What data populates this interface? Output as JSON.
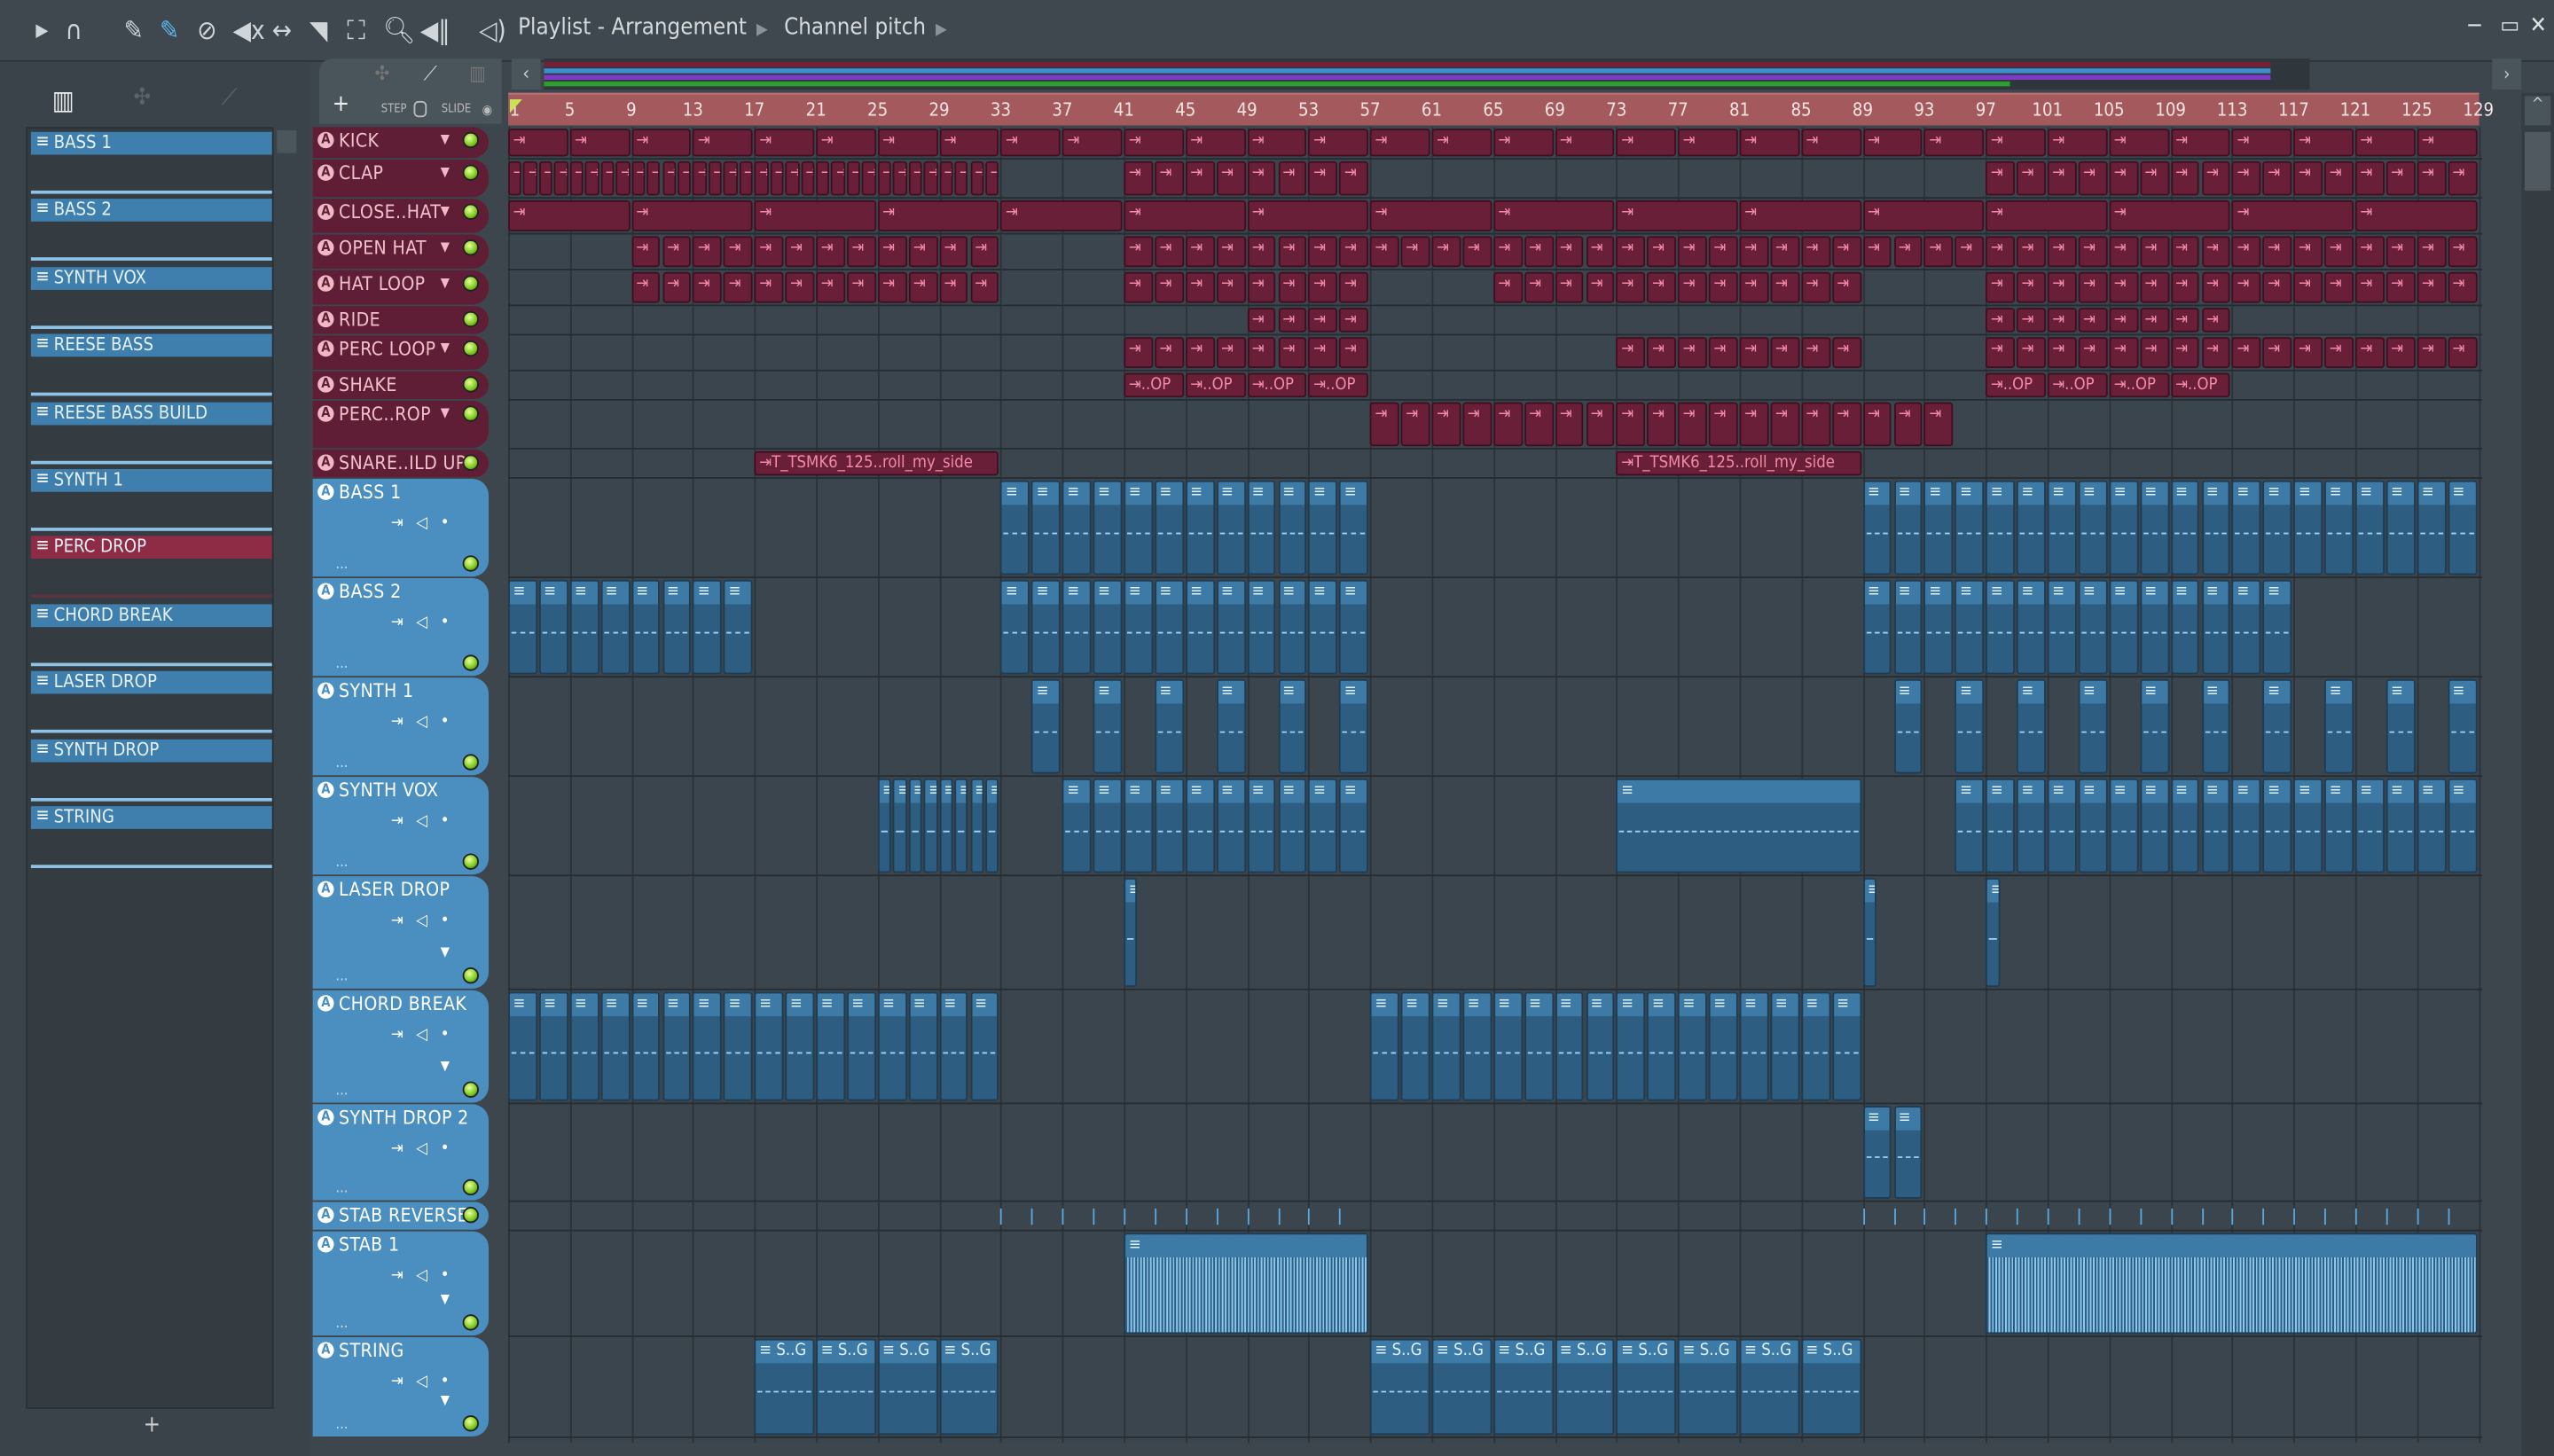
{
  "toolbar": {
    "title": "Playlist - Arrangement",
    "subtitle": "Channel pitch",
    "icons": [
      "play-arrow-icon",
      "magnet-icon",
      "pencil-icon",
      "paint-brush-icon",
      "delete-icon",
      "mute-icon",
      "slip-icon",
      "slice-icon",
      "select-icon",
      "zoom-icon",
      "playback-icon"
    ],
    "step_label": "STEP",
    "slide_label": "SLIDE",
    "add_label": "+"
  },
  "patterns": [
    {
      "label": "BASS 1"
    },
    {
      "label": "BASS 2"
    },
    {
      "label": "SYNTH VOX"
    },
    {
      "label": "REESE BASS"
    },
    {
      "label": "REESE BASS BUILD"
    },
    {
      "label": "SYNTH 1"
    },
    {
      "label": "PERC DROP",
      "red": true
    },
    {
      "label": "CHORD BREAK"
    },
    {
      "label": "LASER DROP"
    },
    {
      "label": "SYNTH DROP"
    },
    {
      "label": "STRING"
    }
  ],
  "pattern_add": "+",
  "ruler": {
    "bars": [
      1,
      5,
      9,
      13,
      17,
      21,
      25,
      29,
      33,
      37,
      41,
      45,
      49,
      53,
      57,
      61,
      65,
      69,
      73,
      77,
      81,
      85,
      89,
      93,
      97,
      101,
      105,
      109,
      113,
      117,
      121,
      125,
      129
    ]
  },
  "colors": {
    "audio": "#6a1f39",
    "pattern": "#2d5d80",
    "ruler": "#a4595d"
  },
  "tracks": [
    {
      "name": "KICK",
      "type": "audio",
      "dd": true,
      "clips": [
        {
          "s": 1,
          "e": 33,
          "len": 4,
          "label": ""
        },
        {
          "s": 33,
          "e": 129,
          "len": 4,
          "label": ""
        }
      ]
    },
    {
      "name": "CLAP",
      "type": "audio",
      "dd": true,
      "clips": [
        {
          "s": 1,
          "e": 33,
          "len": 1,
          "label": ""
        },
        {
          "s": 41,
          "e": 57,
          "len": 2,
          "label": ""
        },
        {
          "s": 97,
          "e": 129,
          "len": 2,
          "label": ""
        }
      ]
    },
    {
      "name": "CLOSE..HAT",
      "type": "audio",
      "dd": true,
      "clips": [
        {
          "s": 1,
          "e": 129,
          "len": 8,
          "label": ""
        }
      ]
    },
    {
      "name": "OPEN HAT",
      "type": "audio",
      "dd": true,
      "clips": [
        {
          "s": 9,
          "e": 33,
          "len": 2,
          "label": ""
        },
        {
          "s": 41,
          "e": 129,
          "len": 2,
          "label": ""
        }
      ]
    },
    {
      "name": "HAT LOOP",
      "type": "audio",
      "dd": true,
      "clips": [
        {
          "s": 9,
          "e": 33,
          "len": 2,
          "label": ""
        },
        {
          "s": 41,
          "e": 57,
          "len": 2,
          "label": ""
        },
        {
          "s": 65,
          "e": 89,
          "len": 2,
          "label": ""
        },
        {
          "s": 97,
          "e": 129,
          "len": 2,
          "label": ""
        }
      ]
    },
    {
      "name": "RIDE",
      "type": "audio",
      "dd": false,
      "clips": [
        {
          "s": 49,
          "e": 57,
          "len": 2,
          "label": ""
        },
        {
          "s": 97,
          "e": 113,
          "len": 2,
          "label": ""
        }
      ]
    },
    {
      "name": "PERC LOOP",
      "type": "audio",
      "dd": true,
      "clips": [
        {
          "s": 41,
          "e": 57,
          "len": 2,
          "label": ""
        },
        {
          "s": 73,
          "e": 89,
          "len": 2,
          "label": ""
        },
        {
          "s": 97,
          "e": 129,
          "len": 2,
          "label": ""
        }
      ]
    },
    {
      "name": "SHAKE",
      "type": "audio",
      "dd": false,
      "clips": [
        {
          "s": 41,
          "e": 57,
          "len": 4,
          "label": "..OP"
        },
        {
          "s": 97,
          "e": 113,
          "len": 4,
          "label": "..OP"
        }
      ]
    },
    {
      "name": "PERC..ROP",
      "type": "audio",
      "dd": true,
      "clips": [
        {
          "s": 57,
          "e": 89,
          "len": 2,
          "label": ""
        },
        {
          "s": 89,
          "e": 95,
          "len": 2,
          "label": ""
        }
      ]
    },
    {
      "name": "SNARE..ILD UP",
      "type": "audio",
      "dd": false,
      "clips": [
        {
          "s": 17,
          "e": 33,
          "len": 16,
          "label": "T_TSMK6_125..roll_my_side"
        },
        {
          "s": 73,
          "e": 89,
          "len": 16,
          "label": "T_TSMK6_125..roll_my_side"
        }
      ]
    },
    {
      "name": "BASS 1",
      "type": "inst",
      "clips": [
        {
          "s": 33,
          "e": 57,
          "len": 2,
          "label": ""
        },
        {
          "s": 89,
          "e": 129,
          "len": 2,
          "label": ""
        }
      ]
    },
    {
      "name": "BASS 2",
      "type": "inst",
      "clips": [
        {
          "s": 1,
          "e": 17,
          "len": 2,
          "label": ""
        },
        {
          "s": 33,
          "e": 57,
          "len": 2,
          "label": ""
        },
        {
          "s": 89,
          "e": 117,
          "len": 2,
          "label": ""
        }
      ]
    },
    {
      "name": "SYNTH 1",
      "type": "inst",
      "clips": [
        {
          "s": 35,
          "e": 57,
          "len": 2,
          "gap": 2,
          "label": ""
        },
        {
          "s": 91,
          "e": 129,
          "len": 2,
          "gap": 2,
          "label": ""
        }
      ]
    },
    {
      "name": "SYNTH VOX",
      "type": "inst",
      "clips": [
        {
          "s": 25,
          "e": 33,
          "len": 1,
          "label": ""
        },
        {
          "s": 37,
          "e": 57,
          "len": 2,
          "label": ""
        },
        {
          "s": 73,
          "e": 89,
          "len": 16,
          "label": ""
        },
        {
          "s": 95,
          "e": 129,
          "len": 2,
          "label": ""
        }
      ]
    },
    {
      "name": "LASER DROP",
      "type": "inst",
      "dd": true,
      "clips": [
        {
          "s": 41,
          "e": 42,
          "len": 1,
          "label": ""
        },
        {
          "s": 89,
          "e": 90,
          "len": 1,
          "label": ""
        },
        {
          "s": 97,
          "e": 98,
          "len": 1,
          "label": ""
        }
      ]
    },
    {
      "name": "CHORD BREAK",
      "type": "inst",
      "dd": true,
      "clips": [
        {
          "s": 1,
          "e": 33,
          "len": 2,
          "label": ""
        },
        {
          "s": 57,
          "e": 89,
          "len": 2,
          "label": ""
        }
      ]
    },
    {
      "name": "SYNTH DROP 2",
      "type": "inst",
      "clips": [
        {
          "s": 89,
          "e": 91,
          "len": 2,
          "label": ""
        },
        {
          "s": 91,
          "e": 93,
          "len": 2,
          "label": ""
        }
      ]
    },
    {
      "name": "STAB REVERSE",
      "type": "inst",
      "small": true,
      "clips": []
    },
    {
      "name": "STAB 1",
      "type": "inst",
      "dd": true,
      "wave": true,
      "clips": [
        {
          "s": 41,
          "e": 57,
          "len": 16,
          "label": ""
        },
        {
          "s": 97,
          "e": 129,
          "len": 32,
          "label": ""
        }
      ]
    },
    {
      "name": "STRING",
      "type": "inst",
      "dd": true,
      "clips": [
        {
          "s": 17,
          "e": 33,
          "len": 4,
          "label": "S..G"
        },
        {
          "s": 57,
          "e": 89,
          "len": 4,
          "label": "S..G"
        }
      ]
    }
  ]
}
